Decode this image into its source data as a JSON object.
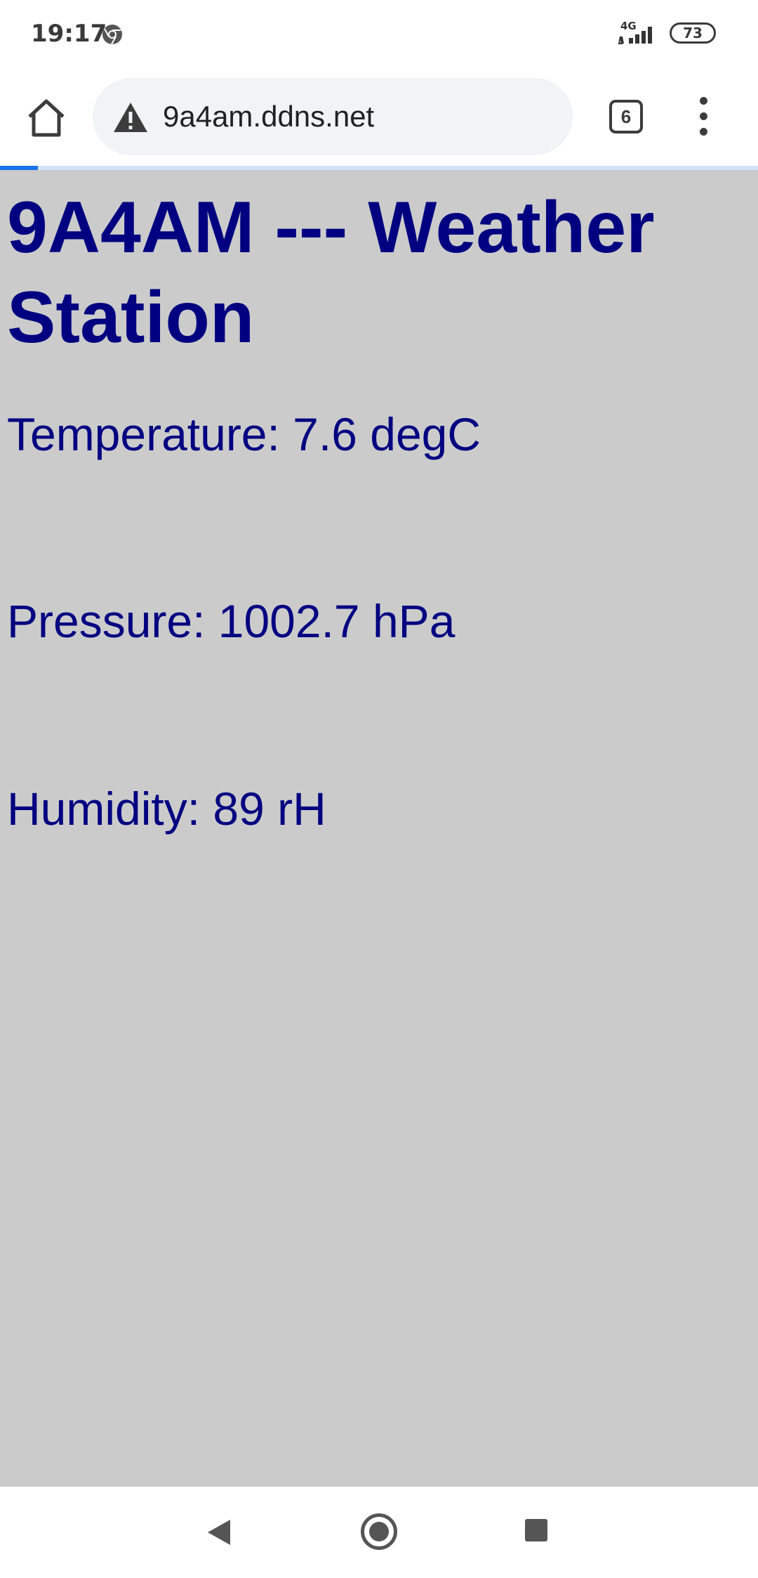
{
  "status_bar": {
    "time": "19:17",
    "network": "4G",
    "battery": "73",
    "icons": [
      "chrome-notification-icon",
      "signal-icon",
      "battery-icon"
    ]
  },
  "browser": {
    "url": "9a4am.ddns.net",
    "security_icon": "warning-icon",
    "tab_count": "6",
    "home_icon": "home-icon",
    "menu_icon": "more-vert-icon",
    "load_progress": 0.05,
    "colors": {
      "progress": "#1a73e8",
      "omnibox_bg": "#f1f3f4"
    }
  },
  "page": {
    "title": "9A4AM --- Weather Station",
    "readings": [
      {
        "label": "Temperature: 7.6 degC"
      },
      {
        "label": "Pressure: 1002.7 hPa"
      },
      {
        "label": "Humidity: 89 rH"
      }
    ],
    "colors": {
      "background": "#cbcbcc",
      "text": "#000080"
    }
  },
  "nav_bar": {
    "icons": [
      "back-icon",
      "home-circle-icon",
      "recents-icon"
    ]
  }
}
